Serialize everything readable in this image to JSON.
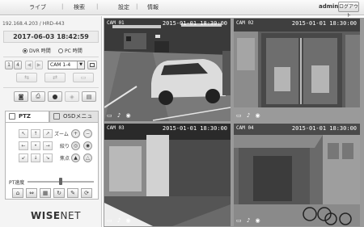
{
  "topbar": {
    "menu": [
      "ライブ",
      "検索",
      "設定",
      "情報"
    ],
    "user": "admin",
    "logout_label": "ログアウト"
  },
  "left_panel": {
    "device_line": "192.168.4.203 / HRD-443",
    "datetime": "2017-06-03 18:42:59",
    "time_source": {
      "dvr": "DVR 時間",
      "pc": "PC 時間",
      "selected": "dvr"
    },
    "camera_select": "CAM 1-4",
    "ptz_tab": "PTZ",
    "osd_tab": "OSDメニュー",
    "zoom_label": "ズーム",
    "focus_label": "焦点",
    "iris_label": "絞り",
    "ptz_speed_label": "PT速度",
    "ptz_speed_level": 0.5,
    "brand": {
      "bold": "WISE",
      "light": "NET"
    }
  },
  "cameras": [
    {
      "label": "CAM 01",
      "timestamp": "2015-01-01 18:30:00"
    },
    {
      "label": "CAM 02",
      "timestamp": "2015-01-01 18:30:00"
    },
    {
      "label": "CAM 03",
      "timestamp": "2015-01-01 18:30:00"
    },
    {
      "label": "CAM 04",
      "timestamp": "2015-01-01 18:30:00"
    }
  ]
}
